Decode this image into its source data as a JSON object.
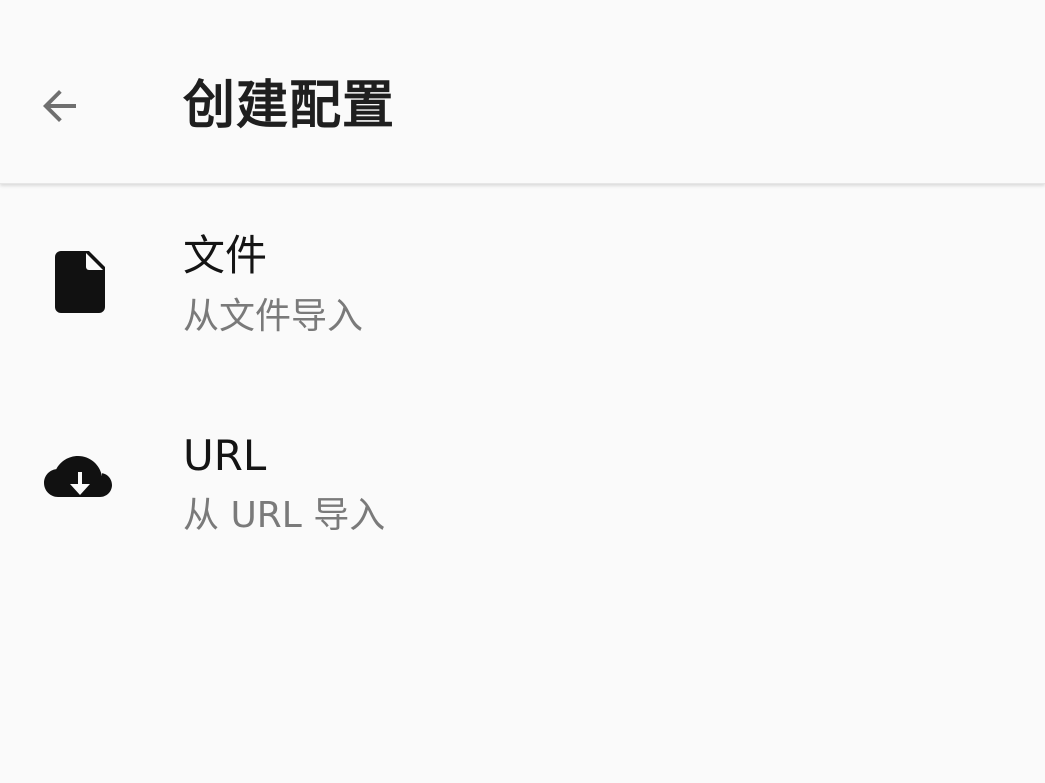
{
  "header": {
    "title": "创建配置",
    "back_icon": "arrow-back-icon"
  },
  "items": [
    {
      "icon": "file-icon",
      "title": "文件",
      "subtitle": "从文件导入"
    },
    {
      "icon": "cloud-download-icon",
      "title": "URL",
      "subtitle": "从 URL 导入"
    }
  ],
  "colors": {
    "background": "#fafafa",
    "title": "#1f1f1f",
    "subtitle": "#7a7a7a",
    "icon": "#111111",
    "back_icon": "#6f6f6f"
  }
}
